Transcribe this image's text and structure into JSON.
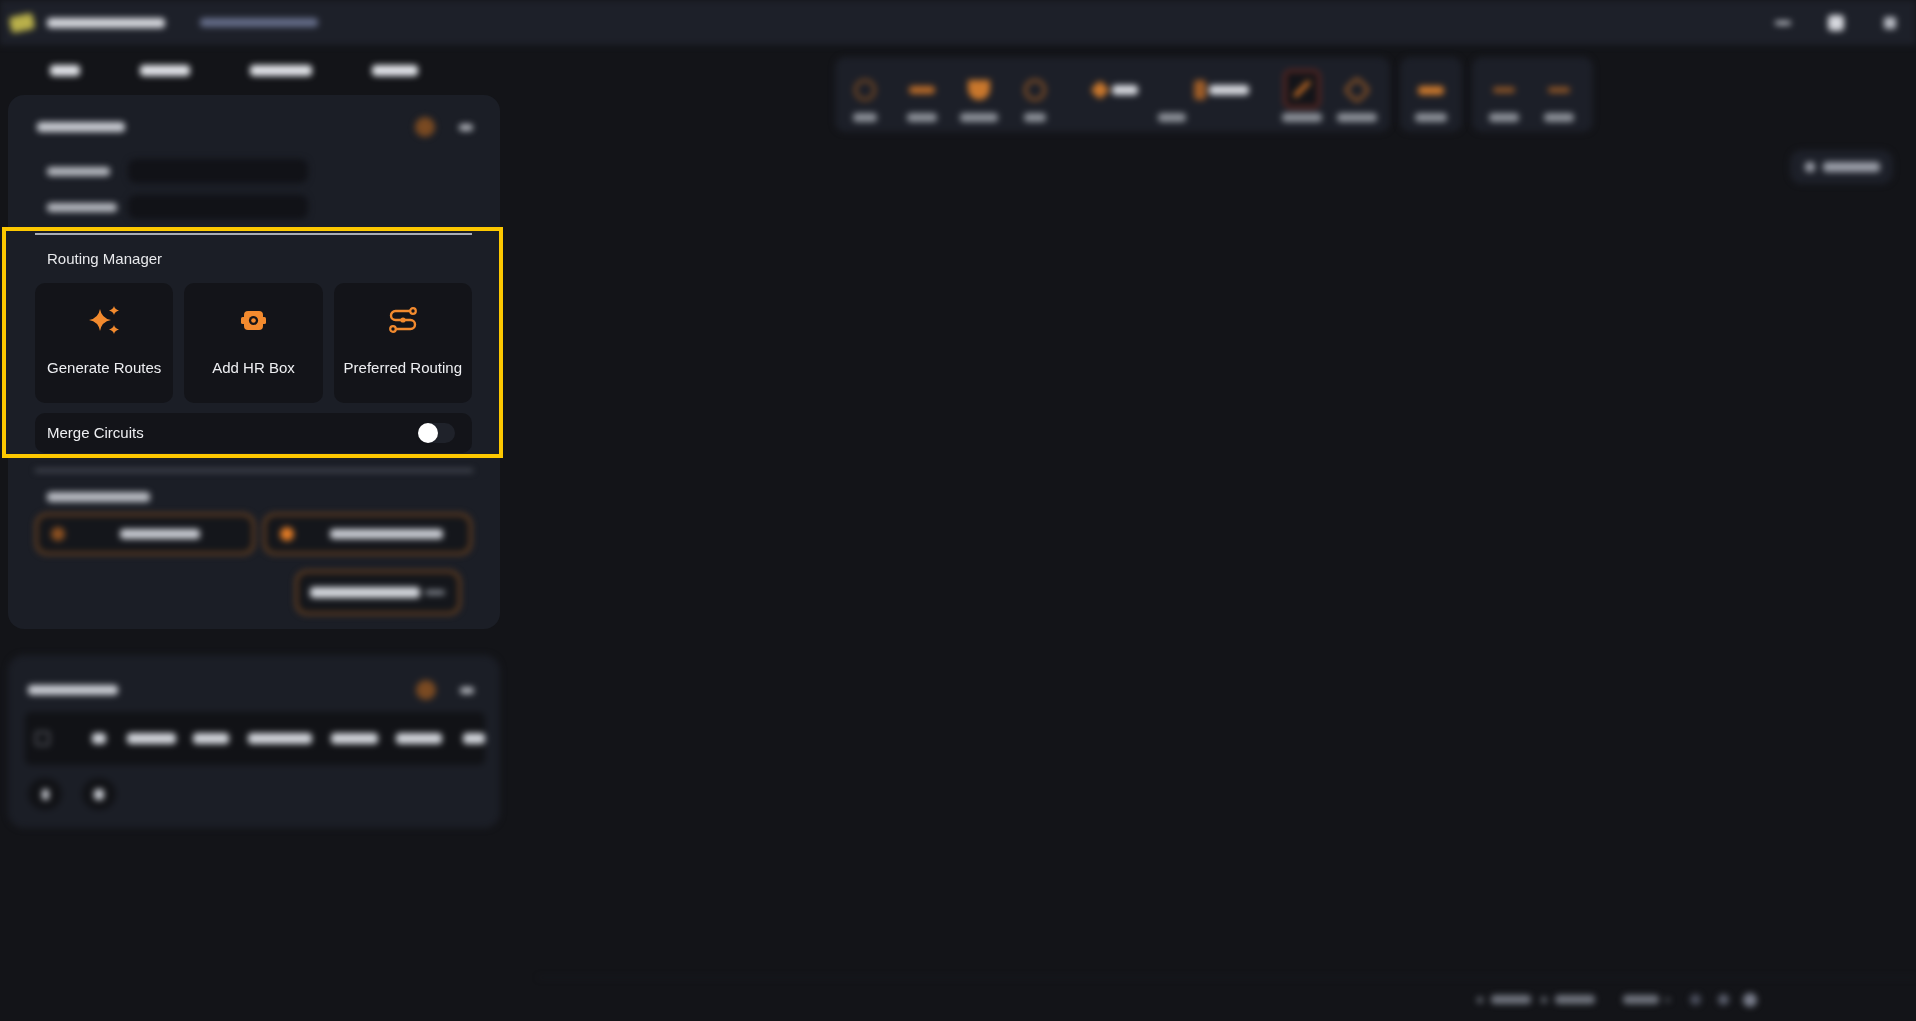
{
  "routing_manager": {
    "highlighted": true,
    "title": "Routing Manager",
    "actions": [
      {
        "label": "Generate Routes"
      },
      {
        "label": "Add HR Box"
      },
      {
        "label": "Preferred Routing"
      }
    ],
    "merge_toggle": {
      "label": "Merge Circuits",
      "on": false
    }
  }
}
